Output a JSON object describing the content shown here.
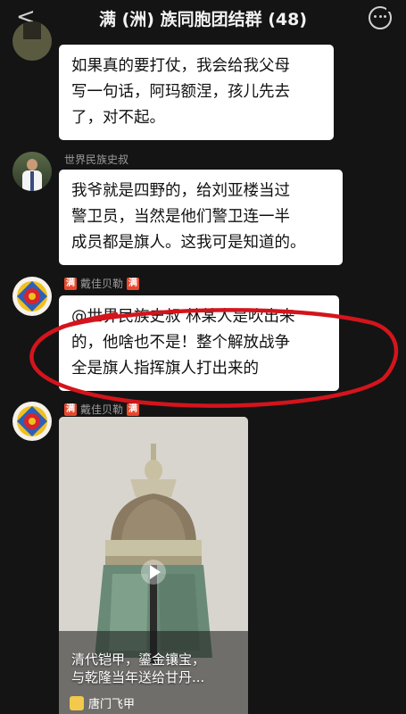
{
  "header": {
    "back_glyph": "<",
    "title": "满 (洲) 族同胞团结群 (48)"
  },
  "messages": [
    {
      "text_lines": [
        "如果真的要打仗，我会给我父母",
        "写一句话，阿玛额涅，孩儿先去",
        "了，对不起。"
      ]
    },
    {
      "sender": "世界民族史叔",
      "text_lines": [
        "我爷就是四野的，给刘亚楼当过",
        "警卫员，当然是他们警卫连一半",
        "成员都是旗人。这我可是知道的。"
      ]
    },
    {
      "sender": "戴佳贝勒",
      "badge": "满",
      "text_lines": [
        "@世界民族史叔 林某人是吹出来",
        "的，他啥也不是！整个解放战争",
        "全是旗人指挥旗人打出来的"
      ]
    },
    {
      "sender": "戴佳贝勒",
      "badge": "满",
      "video": {
        "caption_lines": [
          "清代铠甲，鎏金镶宝，",
          "与乾隆当年送给甘丹..."
        ],
        "source_name": "唐门飞甲"
      }
    }
  ],
  "colors": {
    "background": "#141414",
    "bubble": "#ffffff",
    "badge": "#e8482e",
    "annotation_ring": "#d4141c"
  }
}
